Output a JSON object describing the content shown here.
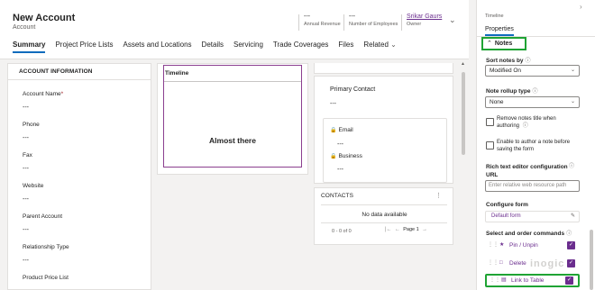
{
  "header": {
    "title": "New Account",
    "subtitle": "Account",
    "fields": [
      {
        "value": "---",
        "label": "Annual Revenue"
      },
      {
        "value": "---",
        "label": "Number of Employees"
      },
      {
        "value": "Srikar Gaurs",
        "label": "Owner"
      }
    ]
  },
  "tabs": [
    "Summary",
    "Project Price Lists",
    "Assets and Locations",
    "Details",
    "Servicing",
    "Trade Coverages",
    "Files",
    "Related"
  ],
  "account_info": {
    "heading": "ACCOUNT INFORMATION",
    "fields": [
      {
        "label": "Account Name",
        "value": "---"
      },
      {
        "label": "Phone",
        "value": "---"
      },
      {
        "label": "Fax",
        "value": "---"
      },
      {
        "label": "Website",
        "value": "---"
      },
      {
        "label": "Parent Account",
        "value": "---"
      },
      {
        "label": "Relationship Type",
        "value": "---"
      },
      {
        "label": "Product Price List",
        "value": ""
      }
    ],
    "required_marker": "*"
  },
  "timeline": {
    "heading": "Timeline",
    "message": "Almost there"
  },
  "primary_contact": {
    "label": "Primary Contact",
    "value": "---",
    "email_label": "Email",
    "email_value": "---",
    "business_label": "Business",
    "business_value": "---"
  },
  "contacts": {
    "heading": "CONTACTS",
    "empty": "No data available",
    "range": "0 - 0 of 0",
    "page": "Page 1"
  },
  "pane": {
    "top_label": "Timeline",
    "tab": "Properties",
    "section": "Notes",
    "sort_label": "Sort notes by",
    "sort_value": "Modified On",
    "rollup_label": "Note rollup type",
    "rollup_value": "None",
    "chk1": "Remove notes title when authoring",
    "chk2": "Enable to author a note before saving the form",
    "rte_label": "Rich text editor configuration URL",
    "rte_placeholder": "Enter relative web resource path",
    "configure_label": "Configure form",
    "configure_value": "Default form",
    "commands_label": "Select and order commands",
    "commands": [
      {
        "label": "Pin / Unpin",
        "icon": "pin-icon"
      },
      {
        "label": "Delete",
        "icon": "trash-icon"
      },
      {
        "label": "Link to Table",
        "icon": "link-table-icon"
      }
    ]
  },
  "watermark": "inogic",
  "colors": {
    "accent": "#6b2e8e",
    "highlight": "#1fa334",
    "brand": "#0f6cbd"
  }
}
